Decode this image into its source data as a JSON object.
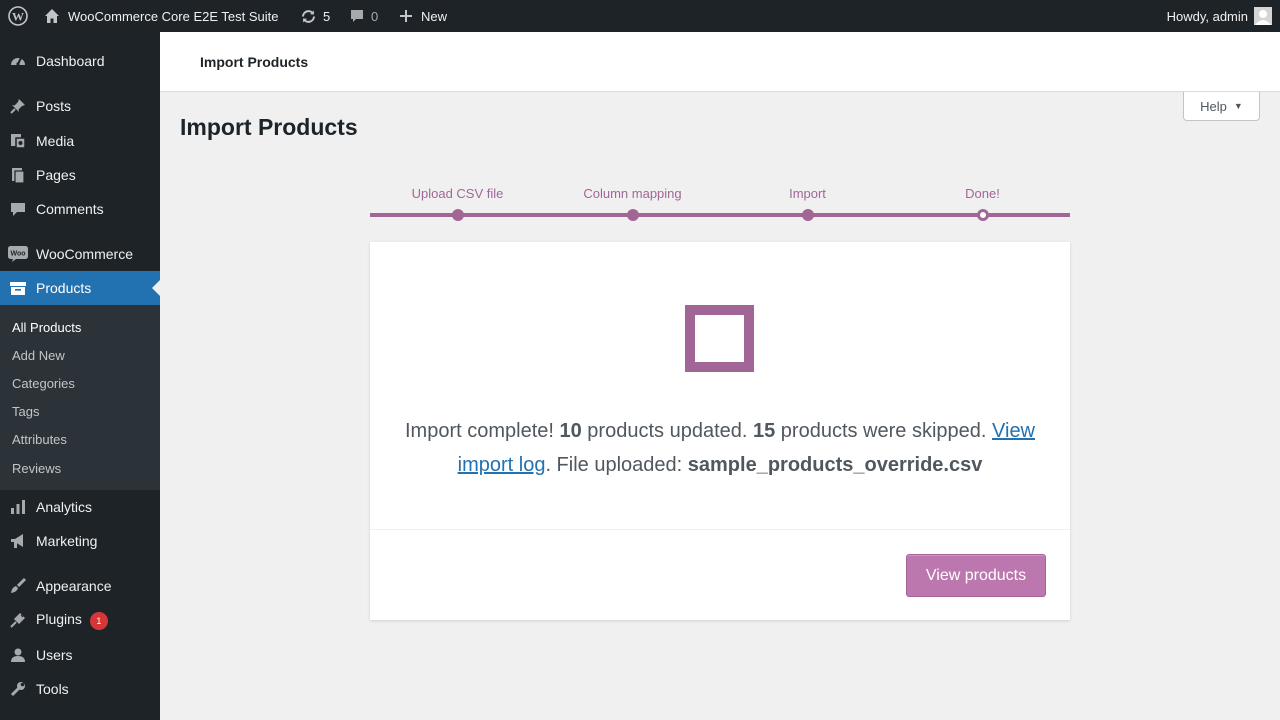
{
  "adminbar": {
    "site_name": "WooCommerce Core E2E Test Suite",
    "updates_count": "5",
    "comments_count": "0",
    "new_label": "New",
    "howdy": "Howdy, admin"
  },
  "sidebar": {
    "items": [
      {
        "label": "Dashboard",
        "icon": "dashboard-icon"
      },
      {
        "label": "Posts",
        "icon": "pin-icon"
      },
      {
        "label": "Media",
        "icon": "media-icon"
      },
      {
        "label": "Pages",
        "icon": "pages-icon"
      },
      {
        "label": "Comments",
        "icon": "comment-icon"
      },
      {
        "label": "WooCommerce",
        "icon": "woo-icon"
      },
      {
        "label": "Products",
        "icon": "archive-icon"
      },
      {
        "label": "Analytics",
        "icon": "bar-chart-icon"
      },
      {
        "label": "Marketing",
        "icon": "megaphone-icon"
      },
      {
        "label": "Appearance",
        "icon": "brush-icon"
      },
      {
        "label": "Plugins",
        "icon": "plugin-icon"
      },
      {
        "label": "Users",
        "icon": "user-icon"
      },
      {
        "label": "Tools",
        "icon": "wrench-icon"
      }
    ],
    "plugins_badge": "1",
    "submenu": [
      "All Products",
      "Add New",
      "Categories",
      "Tags",
      "Attributes",
      "Reviews"
    ],
    "accent_color": "#2271b1"
  },
  "header": {
    "title": "Import Products"
  },
  "help": {
    "label": "Help"
  },
  "page_title": "Import Products",
  "steps": [
    {
      "label": "Upload CSV file",
      "state": "complete"
    },
    {
      "label": "Column mapping",
      "state": "complete"
    },
    {
      "label": "Import",
      "state": "complete"
    },
    {
      "label": "Done!",
      "state": "current"
    }
  ],
  "result": {
    "prefix": "Import complete! ",
    "updated_count": "10",
    "updated_text": " products updated. ",
    "skipped_count": "15",
    "skipped_text": " products were skipped. ",
    "log_link": "View import log",
    "file_text": ". File uploaded: ",
    "file_name": "sample_products_override.csv"
  },
  "view_products_label": "View products",
  "colors": {
    "woo_purple": "#a16696",
    "button_purple": "#bb77ae",
    "link_blue": "#2271b1"
  }
}
